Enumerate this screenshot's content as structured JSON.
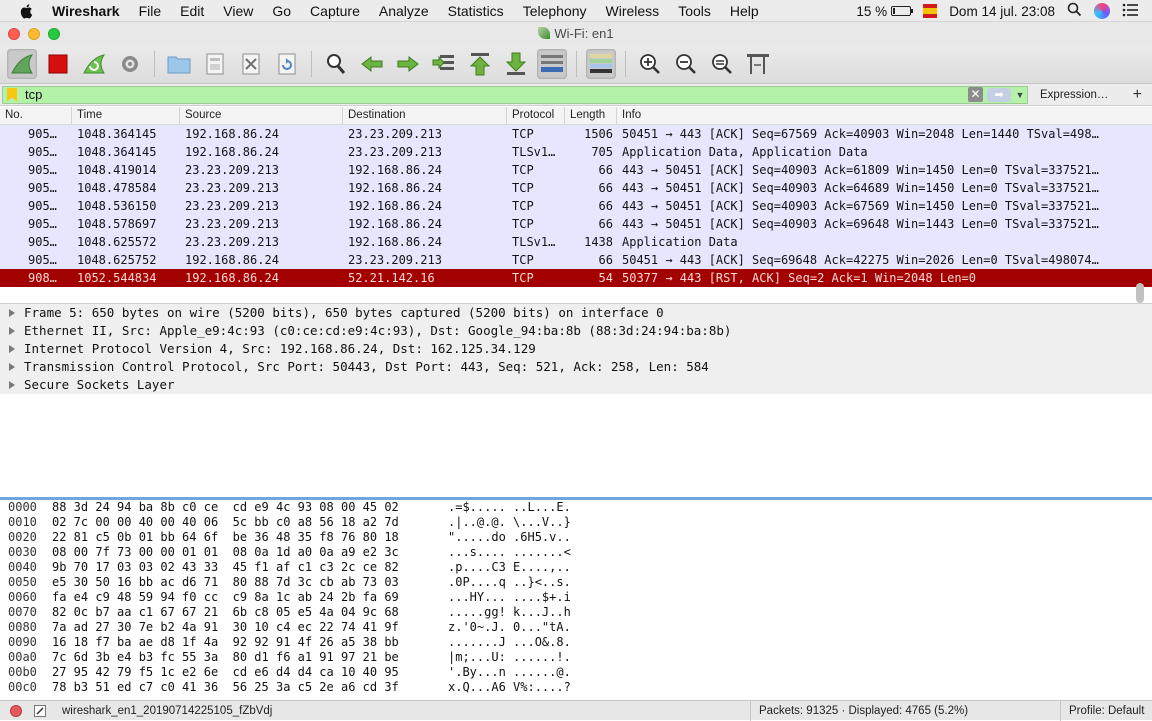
{
  "menubar": {
    "app_name": "Wireshark",
    "items": [
      "File",
      "Edit",
      "View",
      "Go",
      "Capture",
      "Analyze",
      "Statistics",
      "Telephony",
      "Wireless",
      "Tools",
      "Help"
    ],
    "battery": "15 %",
    "battery_level": 0.15,
    "clock": "Dom 14 jul.  23:08"
  },
  "window": {
    "title": "Wi-Fi: en1"
  },
  "toolbar": {
    "icons": [
      "shark-fin-start-icon",
      "stop-capture-icon",
      "restart-capture-icon",
      "capture-options-icon",
      "open-file-icon",
      "save-file-icon",
      "close-file-icon",
      "reload-file-icon",
      "find-packet-icon",
      "go-back-icon",
      "go-forward-icon",
      "go-to-packet-icon",
      "first-packet-icon",
      "last-packet-icon",
      "autoscroll-icon",
      "colorize-icon",
      "zoom-in-icon",
      "zoom-out-icon",
      "normal-size-icon",
      "resize-columns-icon"
    ]
  },
  "filter": {
    "value": "tcp",
    "expression_label": "Expression…",
    "add_label": "+"
  },
  "packet_list": {
    "columns": [
      "No.",
      "Time",
      "Source",
      "Destination",
      "Protocol",
      "Length",
      "Info"
    ],
    "rows": [
      {
        "no": "905…",
        "time": "1048.364145",
        "src": "192.168.86.24",
        "dst": "23.23.209.213",
        "proto": "TCP",
        "len": "1506",
        "info": "50451 → 443 [ACK] Seq=67569 Ack=40903 Win=2048 Len=1440 TSval=498…"
      },
      {
        "no": "905…",
        "time": "1048.364145",
        "src": "192.168.86.24",
        "dst": "23.23.209.213",
        "proto": "TLSv1…",
        "len": "705",
        "info": "Application Data, Application Data"
      },
      {
        "no": "905…",
        "time": "1048.419014",
        "src": "23.23.209.213",
        "dst": "192.168.86.24",
        "proto": "TCP",
        "len": "66",
        "info": "443 → 50451 [ACK] Seq=40903 Ack=61809 Win=1450 Len=0 TSval=337521…"
      },
      {
        "no": "905…",
        "time": "1048.478584",
        "src": "23.23.209.213",
        "dst": "192.168.86.24",
        "proto": "TCP",
        "len": "66",
        "info": "443 → 50451 [ACK] Seq=40903 Ack=64689 Win=1450 Len=0 TSval=337521…"
      },
      {
        "no": "905…",
        "time": "1048.536150",
        "src": "23.23.209.213",
        "dst": "192.168.86.24",
        "proto": "TCP",
        "len": "66",
        "info": "443 → 50451 [ACK] Seq=40903 Ack=67569 Win=1450 Len=0 TSval=337521…"
      },
      {
        "no": "905…",
        "time": "1048.578697",
        "src": "23.23.209.213",
        "dst": "192.168.86.24",
        "proto": "TCP",
        "len": "66",
        "info": "443 → 50451 [ACK] Seq=40903 Ack=69648 Win=1443 Len=0 TSval=337521…"
      },
      {
        "no": "905…",
        "time": "1048.625572",
        "src": "23.23.209.213",
        "dst": "192.168.86.24",
        "proto": "TLSv1…",
        "len": "1438",
        "info": "Application Data"
      },
      {
        "no": "905…",
        "time": "1048.625752",
        "src": "192.168.86.24",
        "dst": "23.23.209.213",
        "proto": "TCP",
        "len": "66",
        "info": "50451 → 443 [ACK] Seq=69648 Ack=42275 Win=2026 Len=0 TSval=498074…"
      },
      {
        "no": "908…",
        "time": "1052.544834",
        "src": "192.168.86.24",
        "dst": "52.21.142.16",
        "proto": "TCP",
        "len": "54",
        "info": "50377 → 443 [RST, ACK] Seq=2 Ack=1 Win=2048 Len=0",
        "selected": true
      }
    ]
  },
  "details": [
    "Frame 5: 650 bytes on wire (5200 bits), 650 bytes captured (5200 bits) on interface 0",
    "Ethernet II, Src: Apple_e9:4c:93 (c0:ce:cd:e9:4c:93), Dst: Google_94:ba:8b (88:3d:24:94:ba:8b)",
    "Internet Protocol Version 4, Src: 192.168.86.24, Dst: 162.125.34.129",
    "Transmission Control Protocol, Src Port: 50443, Dst Port: 443, Seq: 521, Ack: 258, Len: 584",
    "Secure Sockets Layer"
  ],
  "bytes": [
    {
      "off": "0000",
      "hex": "88 3d 24 94 ba 8b c0 ce  cd e9 4c 93 08 00 45 02",
      "ascii": ".=$..... ..L...E."
    },
    {
      "off": "0010",
      "hex": "02 7c 00 00 40 00 40 06  5c bb c0 a8 56 18 a2 7d",
      "ascii": ".|..@.@. \\...V..}"
    },
    {
      "off": "0020",
      "hex": "22 81 c5 0b 01 bb 64 6f  be 36 48 35 f8 76 80 18",
      "ascii": "\".....do .6H5.v.."
    },
    {
      "off": "0030",
      "hex": "08 00 7f 73 00 00 01 01  08 0a 1d a0 0a a9 e2 3c",
      "ascii": "...s.... .......<"
    },
    {
      "off": "0040",
      "hex": "9b 70 17 03 03 02 43 33  45 f1 af c1 c3 2c ce 82",
      "ascii": ".p....C3 E....,.."
    },
    {
      "off": "0050",
      "hex": "e5 30 50 16 bb ac d6 71  80 88 7d 3c cb ab 73 03",
      "ascii": ".0P....q ..}<..s."
    },
    {
      "off": "0060",
      "hex": "fa e4 c9 48 59 94 f0 cc  c9 8a 1c ab 24 2b fa 69",
      "ascii": "...HY... ....$+.i"
    },
    {
      "off": "0070",
      "hex": "82 0c b7 aa c1 67 67 21  6b c8 05 e5 4a 04 9c 68",
      "ascii": ".....gg! k...J..h"
    },
    {
      "off": "0080",
      "hex": "7a ad 27 30 7e b2 4a 91  30 10 c4 ec 22 74 41 9f",
      "ascii": "z.'0~.J. 0...\"tA."
    },
    {
      "off": "0090",
      "hex": "16 18 f7 ba ae d8 1f 4a  92 92 91 4f 26 a5 38 bb",
      "ascii": ".......J ...O&.8."
    },
    {
      "off": "00a0",
      "hex": "7c 6d 3b e4 b3 fc 55 3a  80 d1 f6 a1 91 97 21 be",
      "ascii": "|m;...U: ......!."
    },
    {
      "off": "00b0",
      "hex": "27 95 42 79 f5 1c e2 6e  cd e6 d4 d4 ca 10 40 95",
      "ascii": "'.By...n ......@."
    },
    {
      "off": "00c0",
      "hex": "78 b3 51 ed c7 c0 41 36  56 25 3a c5 2e a6 cd 3f",
      "ascii": "x.Q...A6 V%:....?"
    }
  ],
  "statusbar": {
    "file": "wireshark_en1_20190714225105_fZbVdj",
    "packets": "Packets: 91325 · Displayed: 4765 (5.2%)",
    "profile": "Profile: Default"
  },
  "colors": {
    "row_tcp": "#e7e6ff",
    "row_selected": "#a30000",
    "filter_valid": "#b4f2a9",
    "splitter": "#6fa6df"
  }
}
